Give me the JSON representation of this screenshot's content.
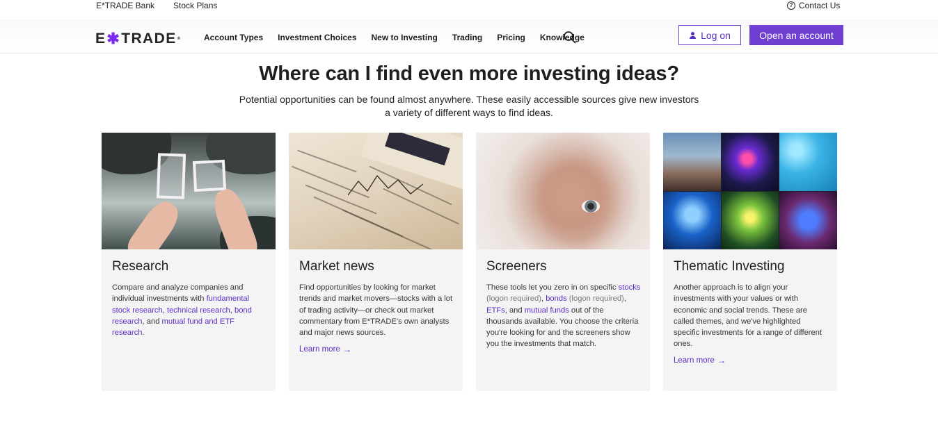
{
  "utility": {
    "bank": "E*TRADE Bank",
    "stock_plans": "Stock Plans",
    "contact": "Contact Us"
  },
  "nav": {
    "logo_left": "E",
    "logo_star": "✱",
    "logo_right": "TRADE",
    "items": [
      "Account Types",
      "Investment Choices",
      "New to Investing",
      "Trading",
      "Pricing",
      "Knowledge"
    ],
    "login": "Log on",
    "open_account": "Open an account"
  },
  "hero": {
    "headline": "Where can I find even more investing ideas?",
    "sub_line1": "Potential opportunities can be found almost anywhere. These easily accessible sources give new investors",
    "sub_line2": "a variety of different ways to find ideas."
  },
  "cards": [
    {
      "title": "Research",
      "t1": "Compare and analyze companies and individual investments with ",
      "l1": "fundamental stock research",
      "t2": ", ",
      "l2": "technical research",
      "t3": ", ",
      "l3": "bond research",
      "t4": ", and ",
      "l4": "mutual fund and ETF research",
      "t5": "."
    },
    {
      "title": "Market news",
      "text": "Find opportunities by looking for market trends and market movers—stocks with a lot of trading activity—or check out market commentary from E*TRADE's own analysts and major news sources.",
      "learn_more": "Learn more"
    },
    {
      "title": "Screeners",
      "t1": "These tools let you zero in on specific ",
      "l1": "stocks",
      "m1": " (logon required)",
      "t2": ", ",
      "l2": "bonds",
      "m2": " (logon required)",
      "t3": ", ",
      "l3": "ETFs",
      "t4": ", and ",
      "l4": "mutual funds",
      "t5": " out of the thousands available. You choose the criteria you're looking for and the screeners show you the investments that match."
    },
    {
      "title": "Thematic Investing",
      "text": "Another approach is to align your investments with your values or with economic and social trends. These are called themes, and we've highlighted specific investments for a range of different ones.",
      "learn_more": "Learn more"
    }
  ],
  "colors": {
    "brand_purple": "#6f3fd1",
    "link_purple": "#5b2cc4",
    "card_bg": "#f4f4f4"
  },
  "icons": [
    "help-circle-icon",
    "search-icon",
    "person-icon",
    "arrow-right-icon"
  ]
}
